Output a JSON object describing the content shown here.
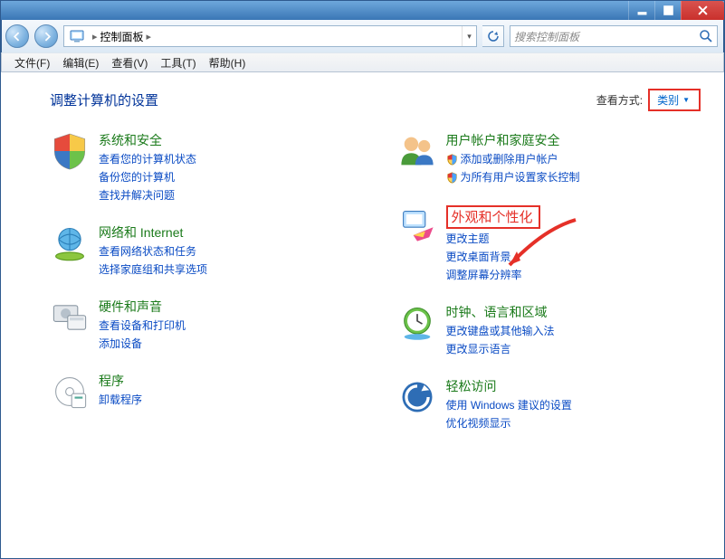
{
  "window": {
    "address_label": "控制面板",
    "search_placeholder": "搜索控制面板"
  },
  "menu": [
    "文件(F)",
    "编辑(E)",
    "查看(V)",
    "工具(T)",
    "帮助(H)"
  ],
  "page": {
    "title": "调整计算机的设置",
    "viewby_label": "查看方式:",
    "viewby_value": "类别"
  },
  "left_col": [
    {
      "head": "系统和安全",
      "links": [
        "查看您的计算机状态",
        "备份您的计算机",
        "查找并解决问题"
      ],
      "shielded": []
    },
    {
      "head": "网络和 Internet",
      "links": [
        "查看网络状态和任务",
        "选择家庭组和共享选项"
      ],
      "shielded": []
    },
    {
      "head": "硬件和声音",
      "links": [
        "查看设备和打印机",
        "添加设备"
      ],
      "shielded": []
    },
    {
      "head": "程序",
      "links": [
        "卸载程序"
      ],
      "shielded": []
    }
  ],
  "right_col": [
    {
      "head": "用户帐户和家庭安全",
      "links": [
        "添加或删除用户帐户",
        "为所有用户设置家长控制"
      ],
      "shielded": [
        0,
        1
      ]
    },
    {
      "head": "外观和个性化",
      "links": [
        "更改主题",
        "更改桌面背景",
        "调整屏幕分辨率"
      ],
      "highlight": true
    },
    {
      "head": "时钟、语言和区域",
      "links": [
        "更改键盘或其他输入法",
        "更改显示语言"
      ]
    },
    {
      "head": "轻松访问",
      "links": [
        "使用 Windows 建议的设置",
        "优化视频显示"
      ]
    }
  ]
}
